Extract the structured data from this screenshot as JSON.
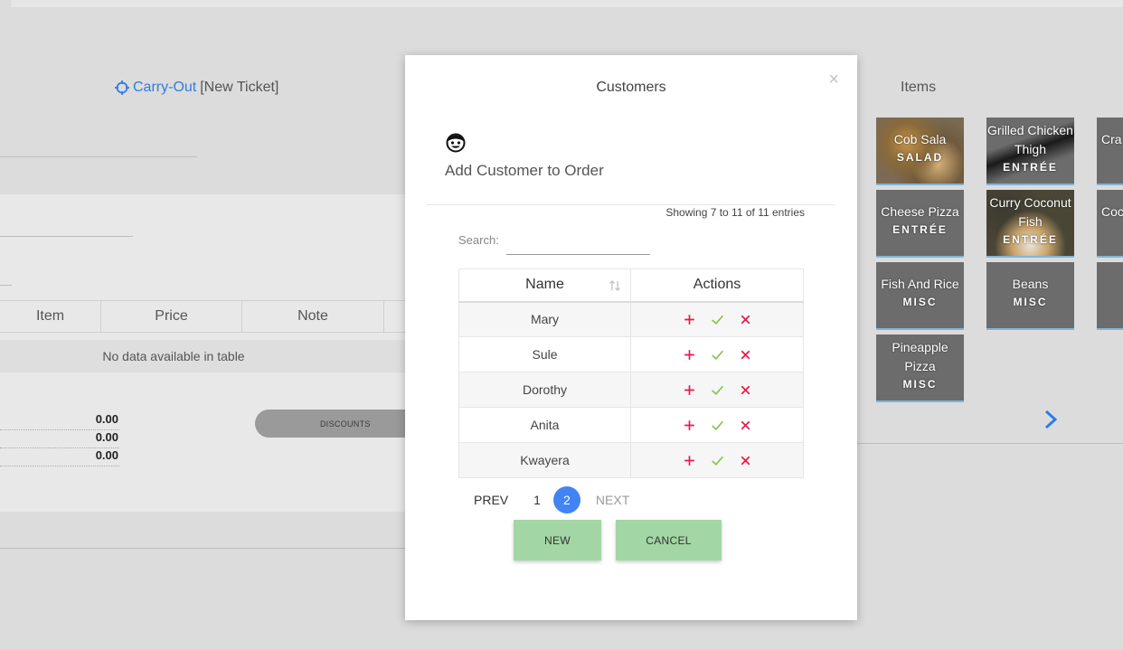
{
  "ticket": {
    "link": "Carry-Out",
    "label": "[New Ticket]"
  },
  "order_table": {
    "columns": [
      "Item",
      "Price",
      "Note"
    ],
    "empty_message": "No data available in table"
  },
  "totals": [
    "0.00",
    "0.00",
    "0.00"
  ],
  "discounts_label": "DISCOUNTS",
  "items_panel": {
    "title": "Items",
    "tiles": [
      {
        "name": "Cob Sala",
        "category": "SALAD"
      },
      {
        "name": "Grilled Chicken Thigh",
        "category": "ENTRÉE"
      },
      {
        "name": "Cra",
        "category": ""
      },
      {
        "name": "Cheese Pizza",
        "category": "ENTRÉE"
      },
      {
        "name": "Curry Coconut Fish",
        "category": "ENTRÉE"
      },
      {
        "name": "Coc",
        "category": ""
      },
      {
        "name": "Fish And Rice",
        "category": "MISC"
      },
      {
        "name": "Beans",
        "category": "MISC"
      },
      {
        "name": "Pineapple Pizza",
        "category": "MISC"
      }
    ]
  },
  "modal": {
    "title": "Customers",
    "close": "×",
    "heading": "Add Customer to Order",
    "showing": "Showing 7 to 11 of 11 entries",
    "search_label": "Search:",
    "search_value": "",
    "columns": {
      "name": "Name",
      "actions": "Actions"
    },
    "rows": [
      "Mary",
      "Sule",
      "Dorothy",
      "Anita",
      "Kwayera"
    ],
    "pager": {
      "prev": "PREV",
      "pages": [
        "1",
        "2"
      ],
      "current": "2",
      "next": "NEXT"
    },
    "buttons": {
      "new": "NEW",
      "cancel": "CANCEL"
    }
  },
  "colors": {
    "accent": "#4284f4",
    "link": "#2f7de1",
    "add": "#e8194a",
    "check": "#8bc34a",
    "remove": "#e8194a",
    "button": "#a2d6a4"
  }
}
